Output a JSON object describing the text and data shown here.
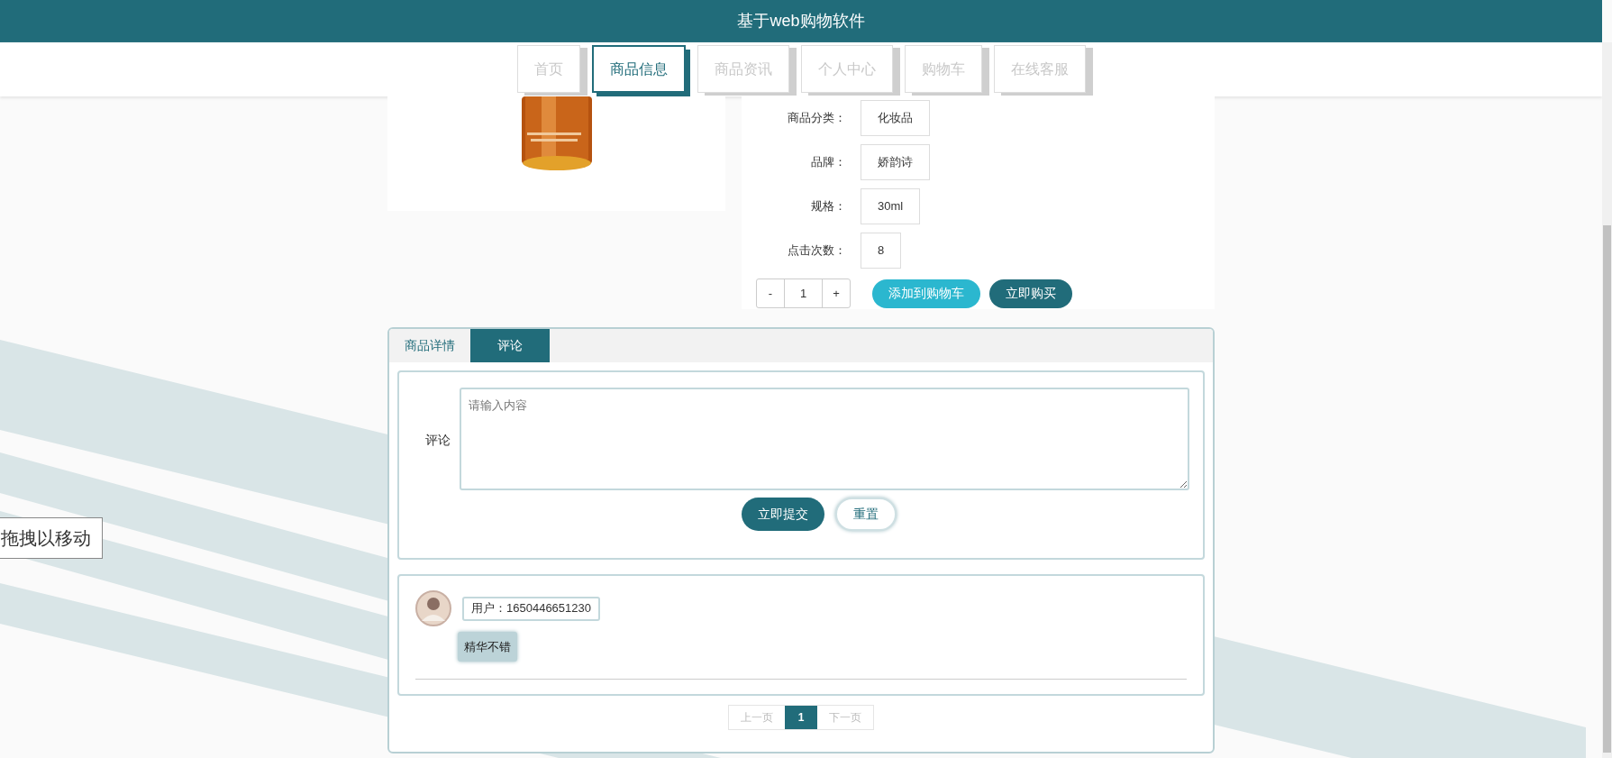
{
  "header": {
    "title": "基于web购物软件"
  },
  "nav": [
    {
      "label": "首页",
      "selected": false
    },
    {
      "label": "商品信息",
      "selected": true
    },
    {
      "label": "商品资讯",
      "selected": false
    },
    {
      "label": "个人中心",
      "selected": false
    },
    {
      "label": "购物车",
      "selected": false
    },
    {
      "label": "在线客服",
      "selected": false
    }
  ],
  "product": {
    "fields": [
      {
        "label": "商品分类：",
        "value": "化妆品"
      },
      {
        "label": "品牌：",
        "value": "娇韵诗"
      },
      {
        "label": "规格：",
        "value": "30ml"
      },
      {
        "label": "点击次数：",
        "value": "8"
      }
    ],
    "quantity": {
      "minus": "-",
      "value": "1",
      "plus": "+"
    },
    "buttons": [
      {
        "label": "添加到购物车",
        "kind": "cart"
      },
      {
        "label": "立即购买",
        "kind": "buy"
      }
    ]
  },
  "detail_tabs": [
    {
      "label": "商品详情",
      "selected": false
    },
    {
      "label": "评论",
      "selected": true
    }
  ],
  "comment_form": {
    "label": "评论",
    "placeholder": "请输入内容",
    "buttons": [
      {
        "label": "立即提交",
        "kind": "primary"
      },
      {
        "label": "重置",
        "kind": "outline"
      }
    ]
  },
  "comments": [
    {
      "user": "用户：1650446651230",
      "text": "精华不错"
    }
  ],
  "pagination": {
    "prev": "上一页",
    "pages": [
      {
        "label": "1",
        "selected": true
      }
    ],
    "next": "下一页"
  },
  "drag_hint": "拖拽以移动"
}
